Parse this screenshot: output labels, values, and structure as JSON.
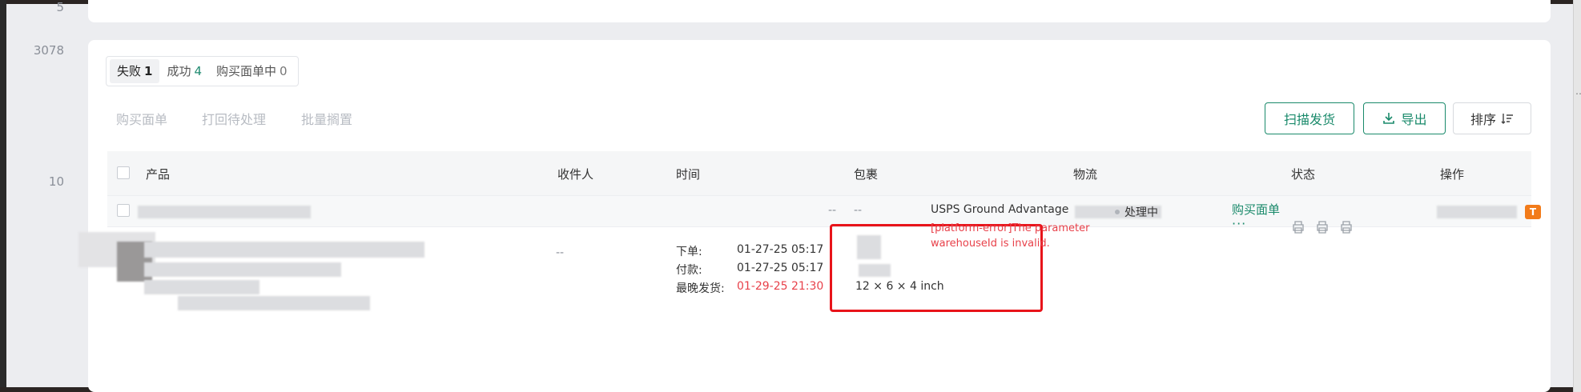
{
  "row_numbers": [
    "5",
    "3078",
    "10"
  ],
  "tabs": [
    {
      "label": "失败",
      "count": "1",
      "active": true
    },
    {
      "label": "成功",
      "count": "4",
      "active": false
    },
    {
      "label": "购买面单中",
      "count": "0",
      "active": false
    }
  ],
  "bulk_actions": [
    "购买面单",
    "打回待处理",
    "批量搁置"
  ],
  "buttons": {
    "scan_ship": "扫描发货",
    "export": "导出",
    "sort": "排序"
  },
  "columns": {
    "product": "产品",
    "recipient": "收件人",
    "time": "时间",
    "package": "包裹",
    "logistics": "物流",
    "status": "状态",
    "actions": "操作"
  },
  "group_row": {
    "dash1": "--",
    "dash2": "--",
    "tag": "T"
  },
  "order": {
    "recipient": "--",
    "times": [
      {
        "label": "下单:",
        "value": "01-27-25 05:17"
      },
      {
        "label": "付款:",
        "value": "01-27-25 05:17"
      },
      {
        "label": "最晚发货:",
        "value": "01-29-25 21:30"
      }
    ],
    "package_dims": "12 × 6 × 4 inch",
    "logistics_service": "USPS Ground Advantage",
    "logistics_error": "[platform-error]The parameter warehouseId is invalid.",
    "status": "处理中",
    "action_buy_label": "购买面单",
    "action_more": "···"
  },
  "colors": {
    "accent": "#1a8a6b",
    "error": "#e8414a",
    "highlight_box": "#e8141a",
    "tag_orange": "#f27b1a"
  },
  "icons": [
    "checkbox",
    "download-icon",
    "sort-icon",
    "printer-icon",
    "status-dot"
  ]
}
